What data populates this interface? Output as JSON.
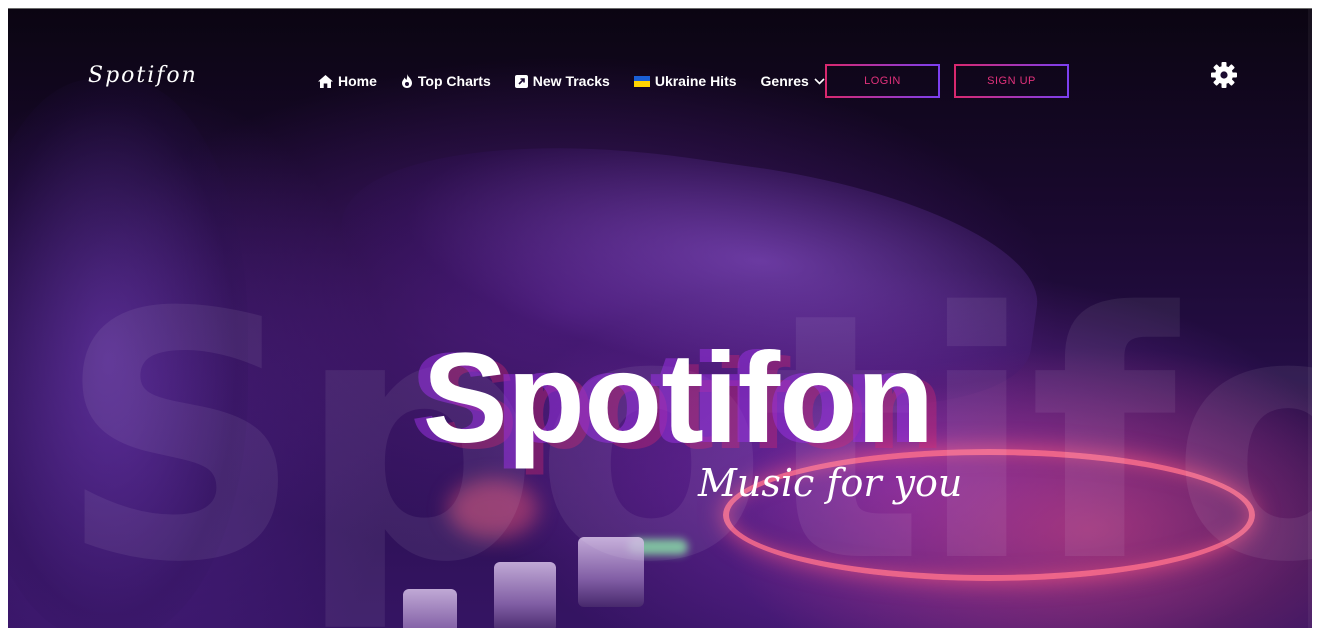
{
  "brand": {
    "logo_text": "Spotifon"
  },
  "nav": {
    "items": [
      {
        "label": "Home",
        "icon": "home-icon"
      },
      {
        "label": "Top Charts",
        "icon": "fire-icon"
      },
      {
        "label": "New Tracks",
        "icon": "arrow-up-right-square-icon"
      },
      {
        "label": "Ukraine Hits",
        "icon": "ukraine-flag-icon"
      },
      {
        "label": "Genres",
        "icon": "chevron-down-icon"
      }
    ],
    "login_label": "LOGIN",
    "signup_label": "SIGN UP",
    "settings_icon": "gear-icon"
  },
  "hero": {
    "watermark": "Spotifon",
    "title": "Spotifon",
    "subtitle": "Music for you"
  },
  "colors": {
    "accent_pink": "#d9286e",
    "accent_purple": "#7c3ff0",
    "text": "#ffffff",
    "background_dark": "#1a0930"
  }
}
